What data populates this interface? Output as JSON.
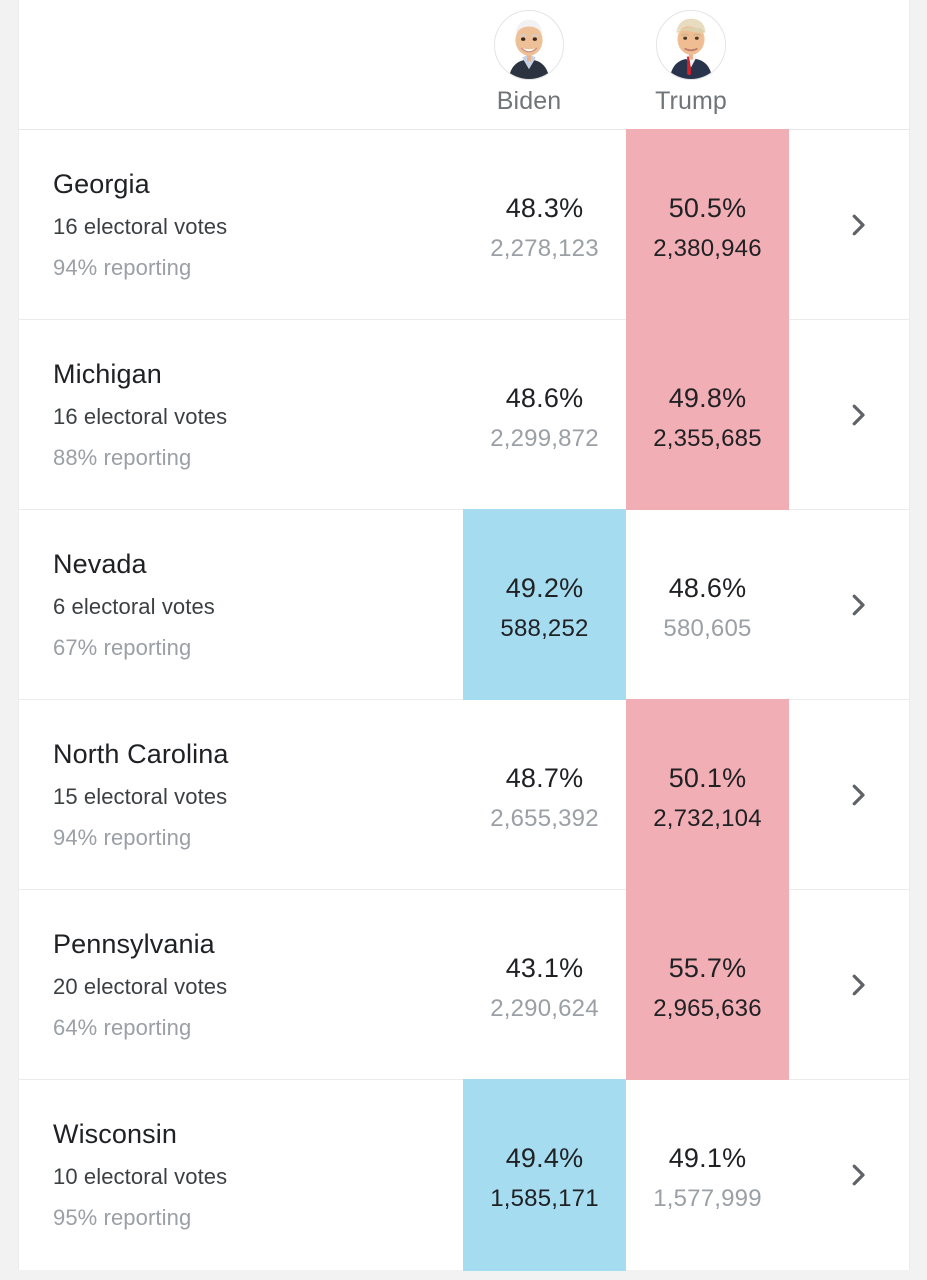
{
  "theme": {
    "page_background": "#f2f2f2",
    "card_background": "#ffffff",
    "lead_blue": "#a6dcf0",
    "lead_pink": "#f1aeb5",
    "text_primary": "#202124",
    "text_secondary": "#3c4043",
    "text_muted": "#9aa0a6",
    "divider": "#ececec"
  },
  "header": {
    "candidates": [
      {
        "name": "Biden",
        "avatar_icon": "biden-avatar-icon",
        "party_color": "#a6dcf0"
      },
      {
        "name": "Trump",
        "avatar_icon": "trump-avatar-icon",
        "party_color": "#f1aeb5"
      }
    ]
  },
  "chevron_icon": "chevron-right-icon",
  "rows": [
    {
      "state": "Georgia",
      "electoral_votes": "16 electoral votes",
      "reporting": "94% reporting",
      "biden": {
        "pct": "48.3%",
        "votes": "2,278,123",
        "leading": false
      },
      "trump": {
        "pct": "50.5%",
        "votes": "2,380,946",
        "leading": true
      }
    },
    {
      "state": "Michigan",
      "electoral_votes": "16 electoral votes",
      "reporting": "88% reporting",
      "biden": {
        "pct": "48.6%",
        "votes": "2,299,872",
        "leading": false
      },
      "trump": {
        "pct": "49.8%",
        "votes": "2,355,685",
        "leading": true
      }
    },
    {
      "state": "Nevada",
      "electoral_votes": "6 electoral votes",
      "reporting": "67% reporting",
      "biden": {
        "pct": "49.2%",
        "votes": "588,252",
        "leading": true
      },
      "trump": {
        "pct": "48.6%",
        "votes": "580,605",
        "leading": false
      }
    },
    {
      "state": "North Carolina",
      "electoral_votes": "15 electoral votes",
      "reporting": "94% reporting",
      "biden": {
        "pct": "48.7%",
        "votes": "2,655,392",
        "leading": false
      },
      "trump": {
        "pct": "50.1%",
        "votes": "2,732,104",
        "leading": true
      }
    },
    {
      "state": "Pennsylvania",
      "electoral_votes": "20 electoral votes",
      "reporting": "64% reporting",
      "biden": {
        "pct": "43.1%",
        "votes": "2,290,624",
        "leading": false
      },
      "trump": {
        "pct": "55.7%",
        "votes": "2,965,636",
        "leading": true
      }
    },
    {
      "state": "Wisconsin",
      "electoral_votes": "10 electoral votes",
      "reporting": "95% reporting",
      "biden": {
        "pct": "49.4%",
        "votes": "1,585,171",
        "leading": true
      },
      "trump": {
        "pct": "49.1%",
        "votes": "1,577,999",
        "leading": false
      }
    }
  ]
}
